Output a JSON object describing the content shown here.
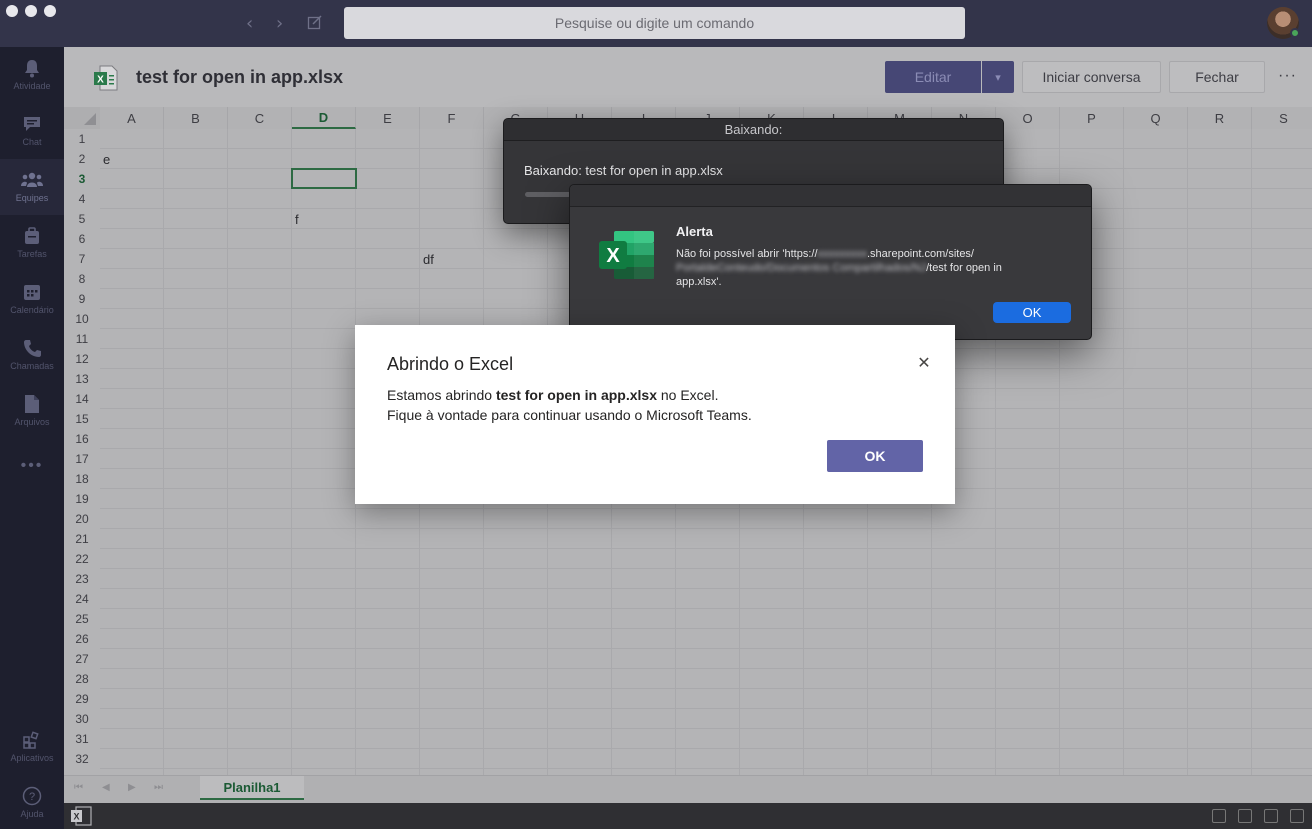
{
  "search": {
    "placeholder": "Pesquise ou digite um comando"
  },
  "nav": {
    "back": "‹",
    "forward": "›"
  },
  "sidebar": {
    "items": [
      {
        "label": "Atividade",
        "icon": "bell-icon"
      },
      {
        "label": "Chat",
        "icon": "chat-icon"
      },
      {
        "label": "Equipes",
        "icon": "teams-icon"
      },
      {
        "label": "Tarefas",
        "icon": "tasks-icon"
      },
      {
        "label": "Calendário",
        "icon": "calendar-icon"
      },
      {
        "label": "Chamadas",
        "icon": "phone-icon"
      },
      {
        "label": "Arquivos",
        "icon": "file-icon"
      }
    ],
    "more": "•••",
    "apps_label": "Aplicativos",
    "help_label": "Ajuda"
  },
  "file": {
    "title": "test for open in app.xlsx",
    "edit_label": "Editar",
    "caret": "▾",
    "start_chat_label": "Iniciar conversa",
    "close_label": "Fechar",
    "more": "···"
  },
  "sheet": {
    "columns": [
      "A",
      "B",
      "C",
      "D",
      "E",
      "F",
      "G",
      "H",
      "I",
      "J",
      "K",
      "L",
      "M",
      "N",
      "O",
      "P",
      "Q",
      "R",
      "S"
    ],
    "rows": [
      "1",
      "2",
      "3",
      "4",
      "5",
      "6",
      "7",
      "8",
      "9",
      "10",
      "11",
      "12",
      "13",
      "14",
      "15",
      "16",
      "17",
      "18",
      "19",
      "20",
      "21",
      "22",
      "23",
      "24",
      "25",
      "26",
      "27",
      "28",
      "29",
      "30",
      "31",
      "32"
    ],
    "selected_column": "D",
    "selected_row": "3",
    "cells": {
      "A2": "e",
      "D5": "f",
      "F7": "df"
    },
    "tab_name": "Planilha1"
  },
  "download_dialog": {
    "title": "Baixando:",
    "message": "Baixando: test for open in app.xlsx"
  },
  "alert": {
    "title": "Alerta",
    "msg_part1": "Não foi possível abrir 'https://",
    "msg_blur1": "xxxxxxxxx",
    "msg_part2": ".sharepoint.com/sites/",
    "msg_blur2": "PortaldeConteudo/Documentos Compartilhados/NJ",
    "msg_part3": "/test for open in",
    "msg_part4": "app.xlsx'.",
    "ok_label": "OK"
  },
  "teams_dialog": {
    "title": "Abrindo o Excel",
    "line1_prefix": "Estamos abrindo ",
    "line1_file": "test for open in app.xlsx",
    "line1_suffix": " no Excel.",
    "line2": "Fique à vontade para continuar usando o Microsoft Teams.",
    "ok_label": "OK",
    "close_symbol": "✕"
  },
  "colors": {
    "teams_purple": "#6264a7",
    "excel_green": "#1d6f42",
    "mac_blue": "#1b6ce0"
  }
}
